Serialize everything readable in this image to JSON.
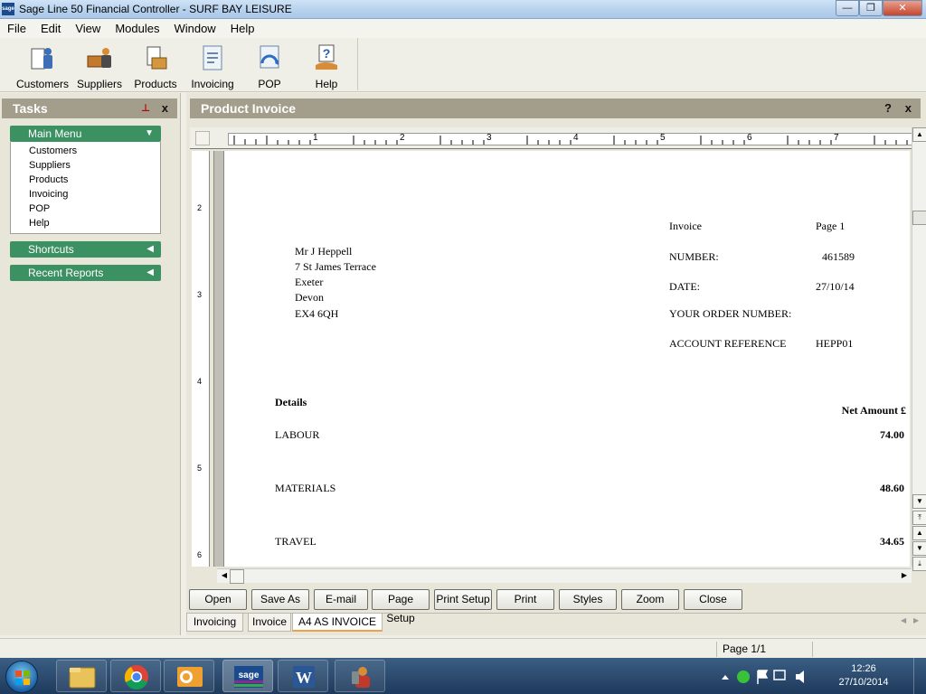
{
  "window": {
    "title": "Sage Line 50 Financial Controller - SURF BAY LEISURE",
    "app_icon_text": "sage",
    "minimize": "—",
    "maximize": "❐",
    "close": "✕"
  },
  "menubar": [
    "File",
    "Edit",
    "View",
    "Modules",
    "Window",
    "Help"
  ],
  "toolbar": [
    {
      "label": "Customers",
      "icon": "customers-icon"
    },
    {
      "label": "Suppliers",
      "icon": "suppliers-icon"
    },
    {
      "label": "Products",
      "icon": "products-icon"
    },
    {
      "label": "Invoicing",
      "icon": "invoicing-icon"
    },
    {
      "label": "POP",
      "icon": "pop-icon"
    },
    {
      "label": "Help",
      "icon": "help-icon"
    }
  ],
  "tasks": {
    "title": "Tasks",
    "pin": "⊥",
    "close": "x",
    "main_menu": {
      "title": "Main Menu",
      "arrow": "▼",
      "items": [
        "Customers",
        "Suppliers",
        "Products",
        "Invoicing",
        "POP",
        "Help"
      ]
    },
    "shortcuts": {
      "title": "Shortcuts",
      "arrow": "◀"
    },
    "recent_reports": {
      "title": "Recent Reports",
      "arrow": "◀"
    }
  },
  "product_invoice": {
    "title": "Product Invoice",
    "help": "?",
    "close": "x",
    "ruler_numbers": [
      "1",
      "2",
      "3",
      "4",
      "5",
      "6",
      "7"
    ],
    "left_ruler_numbers": [
      "2",
      "3",
      "4",
      "5",
      "6"
    ],
    "invoice": {
      "heading": "Invoice",
      "page": "Page 1",
      "address": [
        "Mr J Heppell",
        "7 St James Terrace",
        "Exeter",
        "Devon",
        "EX4 6QH"
      ],
      "number_label": "NUMBER:",
      "number_value": "461589",
      "date_label": "DATE:",
      "date_value": "27/10/14",
      "order_label": "YOUR ORDER NUMBER:",
      "account_label": "ACCOUNT REFERENCE",
      "account_value": "HEPP01",
      "details_header": "Details",
      "amount_header": "Net Amount £",
      "lines": [
        {
          "description": "LABOUR",
          "amount": "74.00"
        },
        {
          "description": "MATERIALS",
          "amount": "48.60"
        },
        {
          "description": "TRAVEL",
          "amount": "34.65"
        }
      ]
    },
    "buttons": [
      "Open",
      "Save As",
      "E-mail",
      "Page Setup",
      "Print Setup",
      "Print",
      "Styles",
      "Zoom",
      "Close"
    ],
    "tabs": [
      "Invoicing",
      "Invoice",
      "A4 AS INVOICE"
    ],
    "active_tab": "A4 AS INVOICE"
  },
  "statusbar": {
    "page": "Page 1/1"
  },
  "taskbar": {
    "apps": [
      "file-explorer",
      "chrome",
      "outlook",
      "sage",
      "word",
      "contacts"
    ],
    "clock_time": "12:26",
    "clock_date": "27/10/2014"
  }
}
